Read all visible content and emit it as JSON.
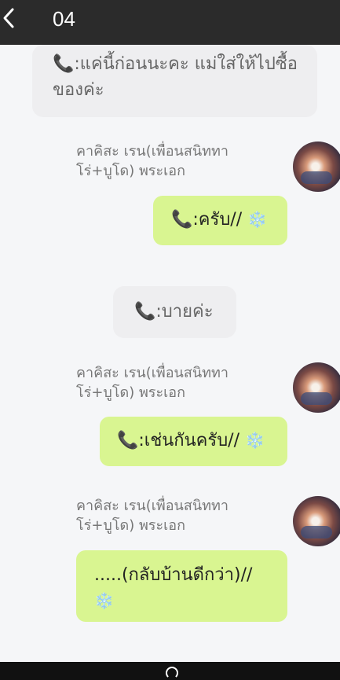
{
  "header": {
    "title": "04",
    "back_icon": "chevron-left-icon"
  },
  "messages": [
    {
      "type": "system",
      "text": "📞:แค่นี้ก่อนนะคะ แม่ใส่ให้ไปซื้อของค่ะ"
    },
    {
      "type": "incoming",
      "sender": "คาคิสะ เรน(เพื่อนสนิททาโร่+บูโด) พระเอก",
      "text": "📞:ครับ//",
      "emoji": "❄️"
    },
    {
      "type": "system",
      "text": "📞:บายค่ะ"
    },
    {
      "type": "incoming",
      "sender": "คาคิสะ เรน(เพื่อนสนิททาโร่+บูโด) พระเอก",
      "text": "📞:เช่นกันครับ//",
      "emoji": "❄️"
    },
    {
      "type": "incoming",
      "sender": "คาคิสะ เรน(เพื่อนสนิททาโร่+บูโด) พระเอก",
      "text": ".....(กลับบ้านดีกว่า)//",
      "emoji": "❄️"
    }
  ],
  "colors": {
    "header_bg": "#2b2b2b",
    "bubble_green": "#d9f591",
    "system_bubble": "#eeeef0",
    "page_bg": "#f5f6f8"
  }
}
